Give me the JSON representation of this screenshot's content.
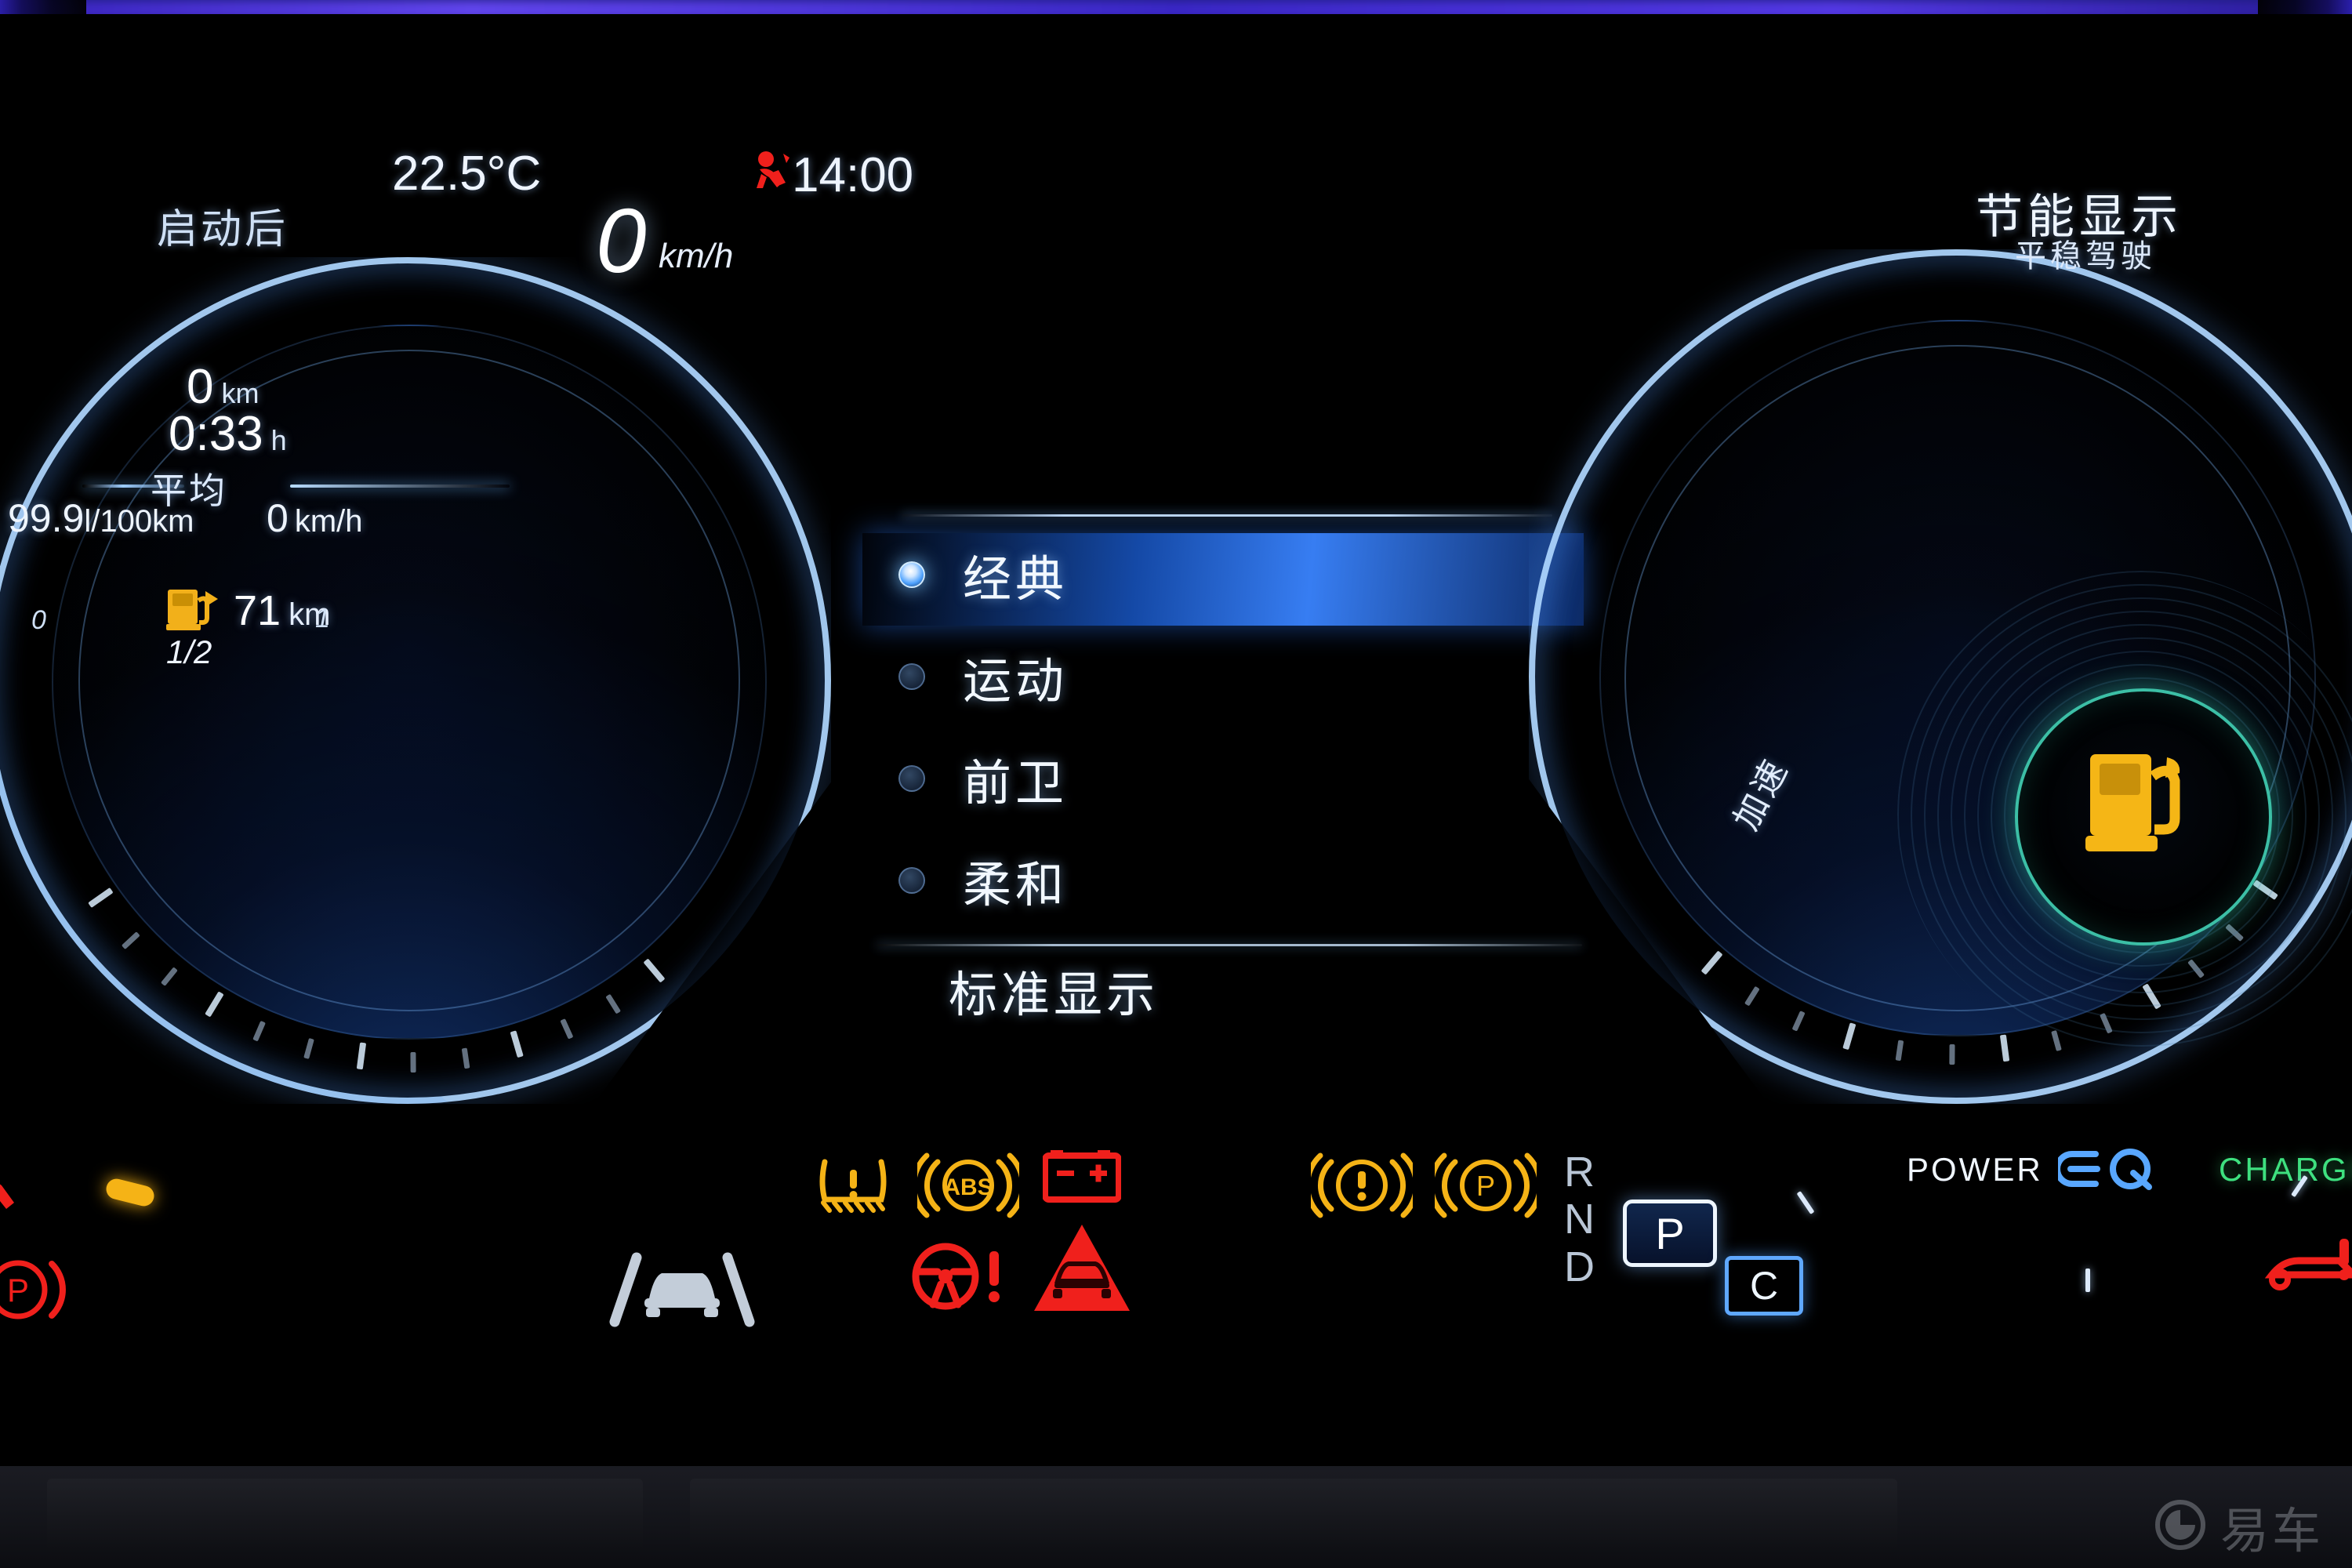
{
  "header": {
    "temperature": "22.5°C",
    "clock": "14:00",
    "speed_value": "0",
    "speed_unit": "km/h"
  },
  "left_gauge": {
    "title": "启动后",
    "trip_distance": "0",
    "trip_distance_unit": "km",
    "trip_time": "0:33",
    "trip_time_unit": "h",
    "average_label": "平均",
    "avg_consumption": "99.9",
    "avg_consumption_unit": "l/100km",
    "avg_speed": "0",
    "avg_speed_unit": "km/h",
    "range_value": "71",
    "range_unit": "km",
    "tank_fraction": "1/2",
    "tick_min": "0",
    "tick_max": "1"
  },
  "center_menu": {
    "items": [
      {
        "label": "经典",
        "selected": true
      },
      {
        "label": "运动",
        "selected": false
      },
      {
        "label": "前卫",
        "selected": false
      },
      {
        "label": "柔和",
        "selected": false
      }
    ],
    "footer_label": "标准显示"
  },
  "right_gauge": {
    "title": "节能显示",
    "subtitle": "平稳驾驶",
    "accel_label": "加速",
    "power_label": "POWER",
    "charge_label": "CHARGE",
    "eq_label": "EQ",
    "center_icon": "fuel-pump-icon"
  },
  "gear": {
    "positions": [
      "R",
      "N",
      "D"
    ],
    "selected": "P",
    "drive_program": "C"
  },
  "telltales": [
    {
      "name": "seatbelt-warning-icon",
      "color": "#f0201c",
      "state": "on"
    },
    {
      "name": "tire-pressure-warning-icon",
      "color": "#f5b316",
      "state": "on"
    },
    {
      "name": "abs-warning-icon",
      "color": "#f5b316",
      "state": "on"
    },
    {
      "name": "battery-charge-warning-icon",
      "color": "#f0201c",
      "state": "on"
    },
    {
      "name": "steering-assist-warning-icon",
      "color": "#f0201c",
      "state": "on"
    },
    {
      "name": "collision-warning-icon",
      "color": "#f0201c",
      "state": "on"
    },
    {
      "name": "brake-fluid-warning-icon",
      "color": "#f5b316",
      "state": "on"
    },
    {
      "name": "parking-brake-warning-icon",
      "color": "#f5b316",
      "state": "on"
    },
    {
      "name": "parking-brake-red-icon",
      "color": "#f0201c",
      "state": "on"
    },
    {
      "name": "lane-keeping-assist-icon",
      "color": "#b9c6d6",
      "state": "off"
    },
    {
      "name": "fuel-pump-range-icon",
      "color": "#f5b316",
      "state": "on"
    }
  ],
  "watermark": {
    "text": "易车"
  },
  "colors": {
    "accent_blue": "#3a84ff",
    "warning_amber": "#f5b316",
    "warning_red": "#f0201c",
    "eco_green": "#3ee07f",
    "eco_ring": "#46e1c3",
    "text_primary": "#eef5ff"
  }
}
